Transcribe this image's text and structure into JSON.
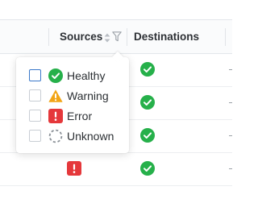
{
  "table": {
    "columns": [
      {
        "key": "sources",
        "label": "Sources"
      },
      {
        "key": "destinations",
        "label": "Destinations"
      }
    ],
    "rows": [
      {
        "sources": null,
        "destinations": "healthy"
      },
      {
        "sources": null,
        "destinations": "healthy"
      },
      {
        "sources": null,
        "destinations": "healthy"
      },
      {
        "sources": "error",
        "destinations": "healthy"
      }
    ]
  },
  "filter_menu": {
    "options": [
      {
        "label": "Healthy",
        "icon": "check-circle-icon",
        "checked": false
      },
      {
        "label": "Warning",
        "icon": "warning-triangle-icon",
        "checked": false
      },
      {
        "label": "Error",
        "icon": "error-square-icon",
        "checked": false
      },
      {
        "label": "Unknown",
        "icon": "dashed-circle-icon",
        "checked": false
      }
    ]
  },
  "colors": {
    "healthy": "#26b04a",
    "warning": "#f2a516",
    "error": "#e5383b",
    "unknown": "#8a9097",
    "focus": "#3a78c9"
  }
}
